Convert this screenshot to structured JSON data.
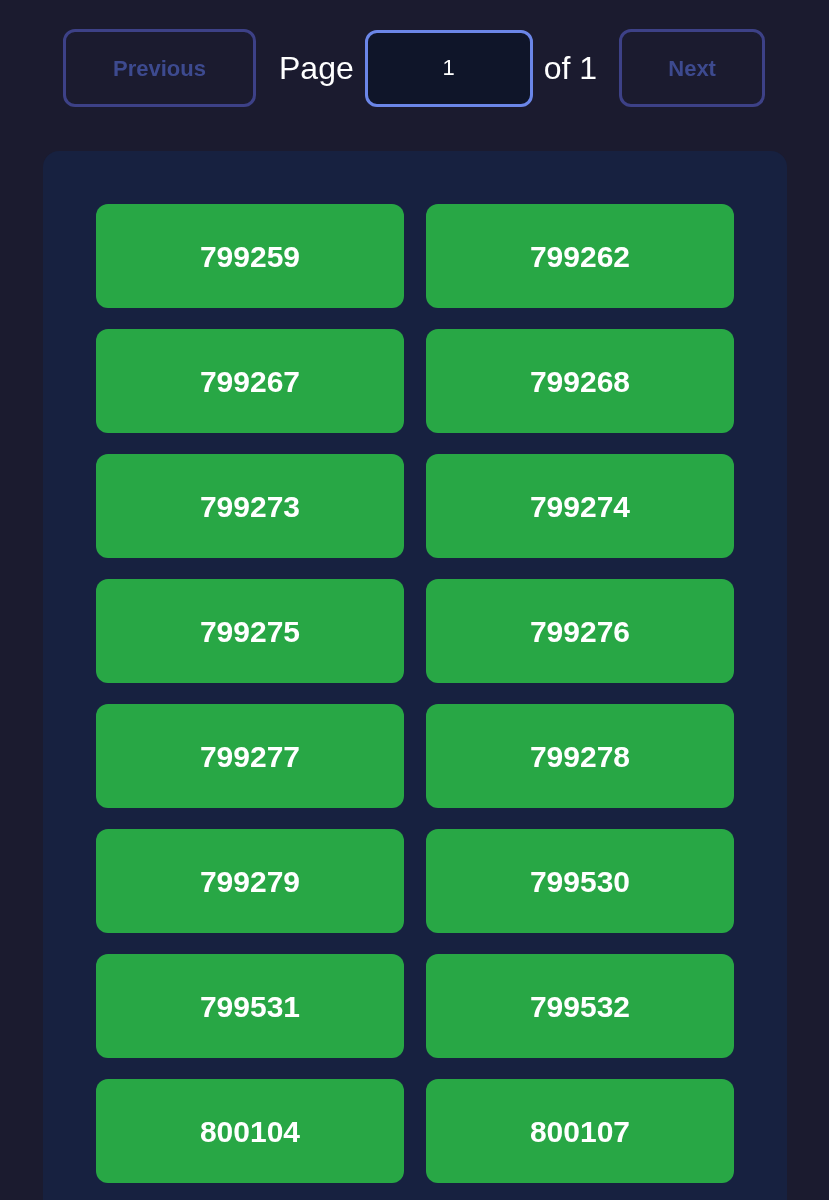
{
  "pagination": {
    "previous": {
      "label": "Previous",
      "disabled": true
    },
    "page_label": "Page",
    "page_input": {
      "value": "1"
    },
    "of_label": "of 1",
    "next": {
      "label": "Next",
      "disabled": true
    }
  },
  "items": [
    "799259",
    "799262",
    "799267",
    "799268",
    "799273",
    "799274",
    "799275",
    "799276",
    "799277",
    "799278",
    "799279",
    "799530",
    "799531",
    "799532",
    "800104",
    "800107"
  ]
}
